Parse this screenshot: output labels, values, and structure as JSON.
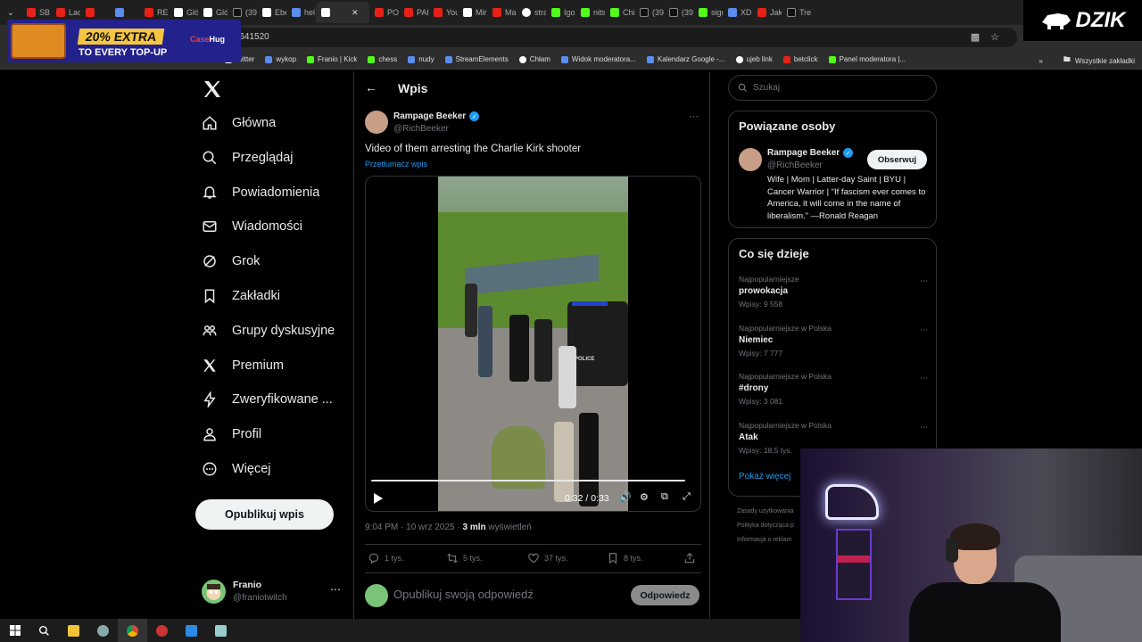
{
  "browser": {
    "tabs": [
      {
        "label": "SB",
        "icon": "youtube"
      },
      {
        "label": "Lad",
        "icon": "youtube"
      },
      {
        "label": "",
        "icon": "youtube"
      },
      {
        "label": "",
        "icon": "misc"
      },
      {
        "label": "REL",
        "icon": "youtube"
      },
      {
        "label": "Gló",
        "icon": "x"
      },
      {
        "label": "Gló",
        "icon": "x"
      },
      {
        "label": "(39",
        "icon": "tiktok"
      },
      {
        "label": "Ebe",
        "icon": "x"
      },
      {
        "label": "hel",
        "icon": "misc"
      },
      {
        "label": "",
        "icon": "x",
        "active": true
      },
      {
        "label": "POL",
        "icon": "youtube"
      },
      {
        "label": "PAI",
        "icon": "youtube"
      },
      {
        "label": "You",
        "icon": "youtube"
      },
      {
        "label": "Mir",
        "icon": "x"
      },
      {
        "label": "Ma",
        "icon": "youtube"
      },
      {
        "label": "stra",
        "icon": "google"
      },
      {
        "label": "Igo",
        "icon": "kick"
      },
      {
        "label": "nits",
        "icon": "kick"
      },
      {
        "label": "Chi",
        "icon": "kick"
      },
      {
        "label": "(39",
        "icon": "tiktok"
      },
      {
        "label": "(39",
        "icon": "tiktok"
      },
      {
        "label": "sigr",
        "icon": "kick"
      },
      {
        "label": "XD",
        "icon": "misc"
      },
      {
        "label": "Jak",
        "icon": "youtube"
      },
      {
        "label": "Tre",
        "icon": "tiktok"
      }
    ],
    "url": "/7641520",
    "bookmarks": [
      {
        "label": "twitter",
        "icon": "x"
      },
      {
        "label": "wykop",
        "icon": "misc"
      },
      {
        "label": "Franio | Kick",
        "icon": "kick"
      },
      {
        "label": "chess",
        "icon": "kick"
      },
      {
        "label": "nudy",
        "icon": "folder"
      },
      {
        "label": "StreamElements",
        "icon": "misc"
      },
      {
        "label": "Chłam",
        "icon": "google"
      },
      {
        "label": "Widok moderatora...",
        "icon": "misc"
      },
      {
        "label": "Kalendarz Google -...",
        "icon": "misc"
      },
      {
        "label": "ujeb link",
        "icon": "google"
      },
      {
        "label": "betclick",
        "icon": "youtube"
      },
      {
        "label": "Panel moderatora |...",
        "icon": "kick"
      }
    ],
    "bookmarks_right": "Wszystkie zakładki"
  },
  "ad": {
    "line1": "20% EXTRA",
    "line2": "TO EVERY TOP-UP",
    "brand_a": "Case",
    "brand_b": "Hug"
  },
  "overlay_logo": "DZIK",
  "nav": {
    "items": [
      {
        "label": "Główna",
        "icon": "home-icon"
      },
      {
        "label": "Przeglądaj",
        "icon": "search-icon"
      },
      {
        "label": "Powiadomienia",
        "icon": "bell-icon"
      },
      {
        "label": "Wiadomości",
        "icon": "mail-icon"
      },
      {
        "label": "Grok",
        "icon": "grok-icon"
      },
      {
        "label": "Zakładki",
        "icon": "bookmark-icon"
      },
      {
        "label": "Grupy dyskusyjne",
        "icon": "people-icon"
      },
      {
        "label": "Premium",
        "icon": "x-icon"
      },
      {
        "label": "Zweryfikowane ...",
        "icon": "lightning-icon"
      },
      {
        "label": "Profil",
        "icon": "person-icon"
      },
      {
        "label": "Więcej",
        "icon": "more-circle-icon"
      }
    ],
    "post_button": "Opublikuj wpis",
    "profile": {
      "name": "Franio",
      "handle": "@franiotwitch"
    }
  },
  "post": {
    "header_title": "Wpis",
    "author_name": "Rampage Beeker",
    "author_handle": "@RichBeeker",
    "text": "Video of them arresting the Charlie Kirk shooter",
    "translate": "Przetłumacz wpis",
    "video_time": "0:32 / 0:33",
    "video_progress": 0.97,
    "video_overlay_text": "POLICE",
    "timestamp": "9:04 PM · 10 wrz 2025 · ",
    "views_count": "3 mln",
    "views_label": " wyświetleń",
    "replies": "1 tys.",
    "reposts": "5 tys.",
    "likes": "37 tys.",
    "bookmarks": "8 tys.",
    "reply_placeholder": "Opublikuj swoją odpowiedź",
    "reply_button": "Odpowiedz"
  },
  "sidebar": {
    "search_placeholder": "Szukaj",
    "related_title": "Powiązane osoby",
    "related": {
      "name": "Rampage Beeker",
      "handle": "@RichBeeker",
      "follow": "Obserwuj",
      "bio": "Wife | Mom | Latter-day Saint | BYU | Cancer Warrior | “If fascism ever comes to America, it will come in the name of liberalism.” —Ronald Reagan"
    },
    "trends_title": "Co się dzieje",
    "trends": [
      {
        "context": "Najpopularniejsze",
        "name": "prowokacja",
        "count": "Wpisy: 9 558"
      },
      {
        "context": "Najpopularniejsze w Polska",
        "name": "Niemiec",
        "count": "Wpisy: 7 777"
      },
      {
        "context": "Najpopularniejsze w Polska",
        "name": "#drony",
        "count": "Wpisy: 3 081"
      },
      {
        "context": "Najpopularniejsze w Polska",
        "name": "Atak",
        "count": "Wpisy: 18,5 tys."
      }
    ],
    "show_more": "Pokaż więcej",
    "footer": [
      "Zasady użytkowania",
      "Polityka dotycząca p",
      "Informacja o reklam"
    ]
  }
}
